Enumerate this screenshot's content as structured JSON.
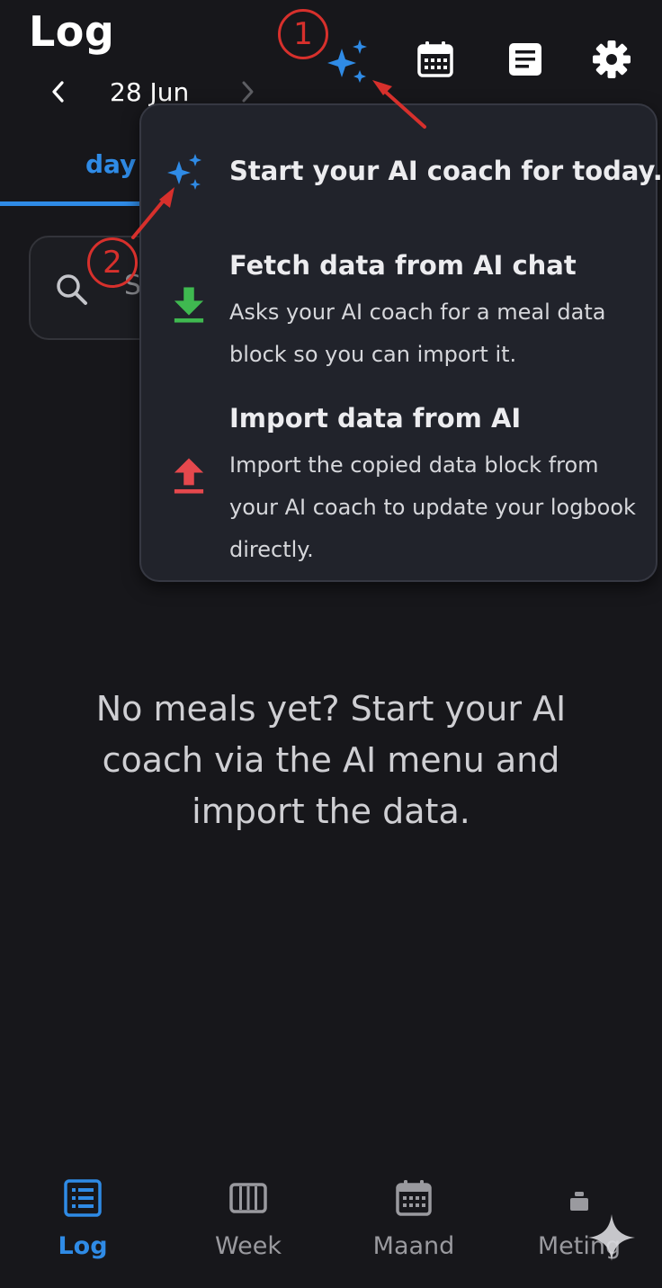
{
  "header": {
    "title": "Log",
    "date": "28 Jun"
  },
  "tabs": {
    "day": "day"
  },
  "search": {
    "placeholder": "S"
  },
  "ai_menu": {
    "start": {
      "title": "Start your AI coach for today.",
      "icon": "sparkles-icon"
    },
    "fetch": {
      "title": "Fetch data from AI chat",
      "description": "Asks your AI coach for a meal data block so you can import it.",
      "icon": "download-icon"
    },
    "import": {
      "title": "Import data from AI",
      "description": "Import the copied data block from your AI coach to update your logbook directly.",
      "icon": "upload-icon"
    }
  },
  "annotations": {
    "step1": "1",
    "step2": "2"
  },
  "empty_state": {
    "message": "No meals yet? Start your AI coach via the AI menu and import the data."
  },
  "bottom_nav": {
    "log": "Log",
    "week": "Week",
    "maand": "Maand",
    "meting": "Meting"
  },
  "colors": {
    "accent": "#2f8be6",
    "background": "#17171b",
    "menu_bg": "#21232b",
    "download_green": "#3fb950",
    "upload_red": "#e5484d",
    "annotation_red": "#d7302c"
  }
}
